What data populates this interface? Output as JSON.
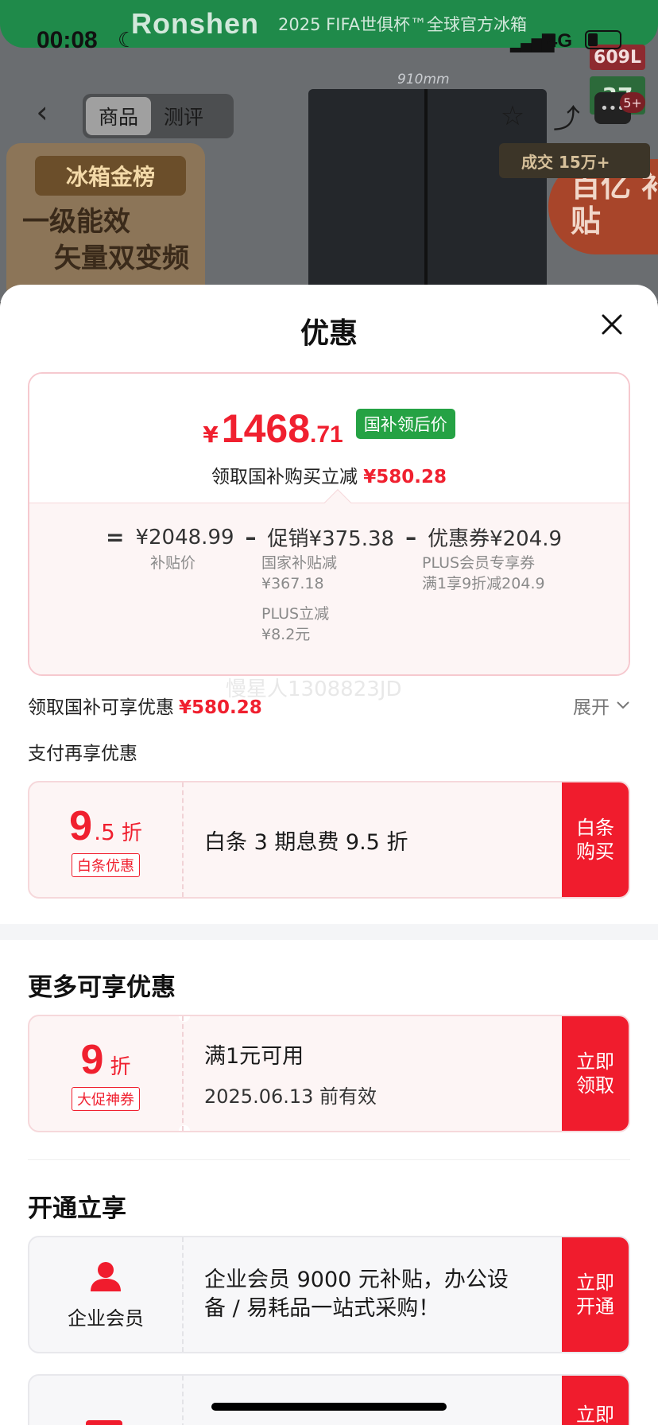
{
  "status_bar": {
    "time": "00:08",
    "network": "4G"
  },
  "background": {
    "brand": "Ronshen",
    "promo": "2025 FIFA世俱杯™全球官方冰箱",
    "dimension": "910mm",
    "capacity_badge": "609L",
    "badge2": "37",
    "gold_title": "冰箱金榜",
    "gold_lines": [
      "一级能效",
      "矢量双变频"
    ],
    "deal_text": "成交 15万+",
    "subsidy_text": "百亿 补贴",
    "nav_tabs": [
      "商品",
      "测评"
    ],
    "more_badge": "5+"
  },
  "sheet": {
    "title": "优惠",
    "price_card": {
      "currency": "¥",
      "final_int": "1468",
      "final_dec": ".71",
      "final_tag": "国补领后价",
      "save_text": "领取国补购买立减",
      "save_amount": "¥580.28",
      "eq": "=",
      "base_price": "¥2048.99",
      "base_label": "补贴价",
      "minus": "–",
      "promo": "促销¥375.38",
      "promo_detail1_label": "国家补贴减",
      "promo_detail1_value": "¥367.18",
      "promo_detail2_label": "PLUS立减",
      "promo_detail2_value": "¥8.2元",
      "coupon": "优惠券¥204.9",
      "coupon_detail1": "PLUS会员专享券",
      "coupon_detail2": "满1享9折减204.9"
    },
    "summary": {
      "text": "领取国补可享优惠",
      "amount": "¥580.28",
      "expand": "展开"
    },
    "pay_label": "支付再享优惠",
    "baitiao": {
      "big": "9",
      "small": ".5",
      "zhe": "折",
      "tag": "白条优惠",
      "desc": "白条 3 期息费 9.5 折",
      "button": "白条购买"
    },
    "more_heading": "更多可享优惠",
    "coupon_offer": {
      "big": "9",
      "zhe": "折",
      "tag": "大促神券",
      "line1": "满1元可用",
      "line2": "2025.06.13 前有效",
      "button": "立即领取"
    },
    "open_heading": "开通立享",
    "enterprise": {
      "label": "企业会员",
      "desc": "企业会员 9000 元补贴，办公设备 / 易耗品一站式采购！",
      "button": "立即开通"
    },
    "partial_button": "立即",
    "watermark": "慢星人1308823JD"
  },
  "colors": {
    "accent": "#f01c2d",
    "tag_green": "#25a244",
    "card_pink": "#fdf5f5"
  }
}
